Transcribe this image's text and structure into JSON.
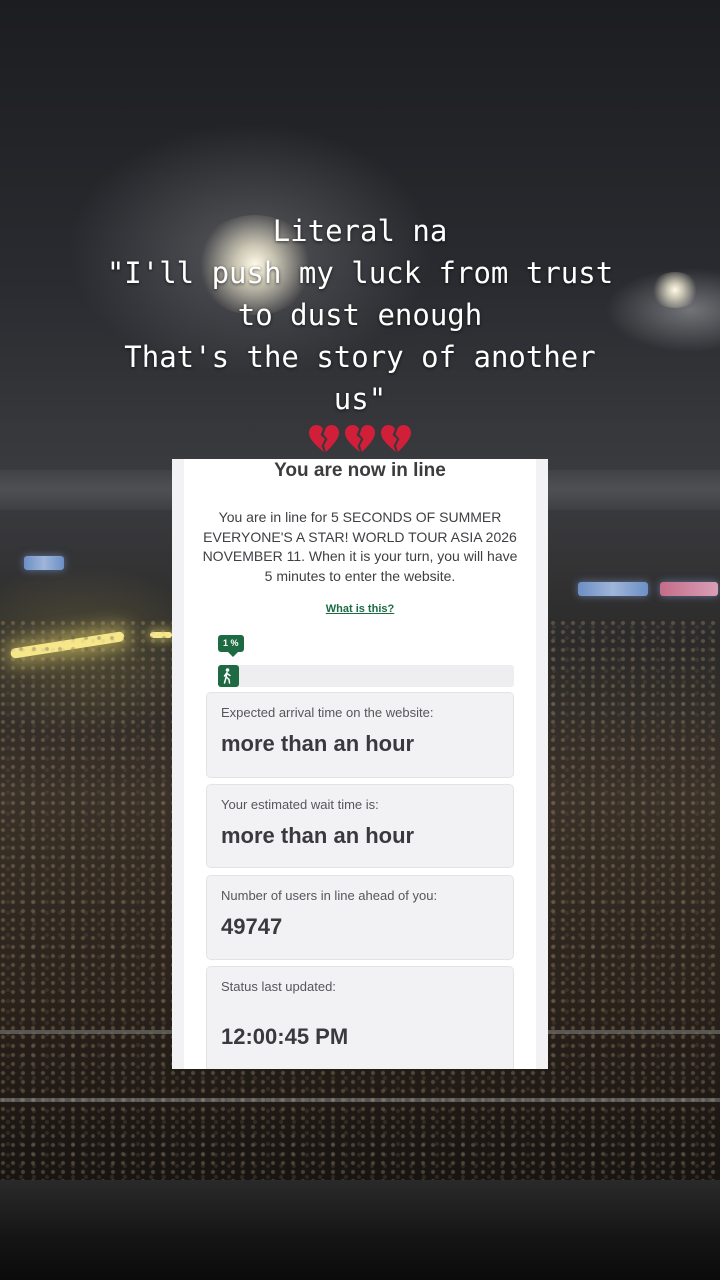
{
  "caption": {
    "lines": [
      "Literal na",
      "\"I'll push my luck from trust",
      "to dust enough",
      "That's the story of another",
      "us\""
    ],
    "emoji": [
      "broken-heart",
      "broken-heart",
      "broken-heart"
    ]
  },
  "queue": {
    "title": "You are now in line",
    "description": "You are in line for 5 SECONDS OF SUMMER EVERYONE'S A STAR! WORLD TOUR ASIA 2026 NOVEMBER 11. When it is your turn, you will have 5 minutes to enter the website.",
    "help_link": "What is this?",
    "progress_label": "1 %",
    "progress_fraction": 0.01,
    "boxes": [
      {
        "label": "Expected arrival time on the website:",
        "value": "more than an hour"
      },
      {
        "label": "Your estimated wait time is:",
        "value": "more than an hour"
      },
      {
        "label": "Number of users in line ahead of you:",
        "value": "49747"
      },
      {
        "label": "Status last updated:",
        "value": "12:00:45 PM"
      }
    ]
  },
  "colors": {
    "accent": "#1e6b43",
    "box_bg": "#f2f2f4",
    "heart": "#d11f3a"
  }
}
